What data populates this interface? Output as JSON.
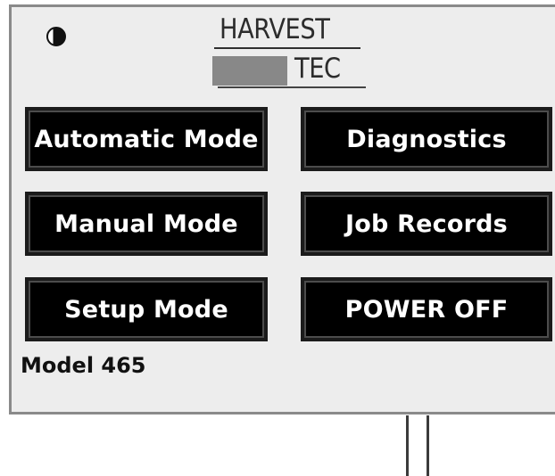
{
  "logo": {
    "line1": "HARVEST",
    "line2": "TEC"
  },
  "icons": {
    "contrast": "contrast-icon"
  },
  "buttons": {
    "automatic_mode": "Automatic Mode",
    "diagnostics": "Diagnostics",
    "manual_mode": "Manual Mode",
    "job_records": "Job Records",
    "setup_mode": "Setup Mode",
    "power_off": "POWER OFF"
  },
  "footer": {
    "model": "Model 465"
  },
  "colors": {
    "panel_background": "#ededed",
    "button_background": "#000000",
    "button_text": "#ffffff",
    "logo_accent": "#888888"
  }
}
